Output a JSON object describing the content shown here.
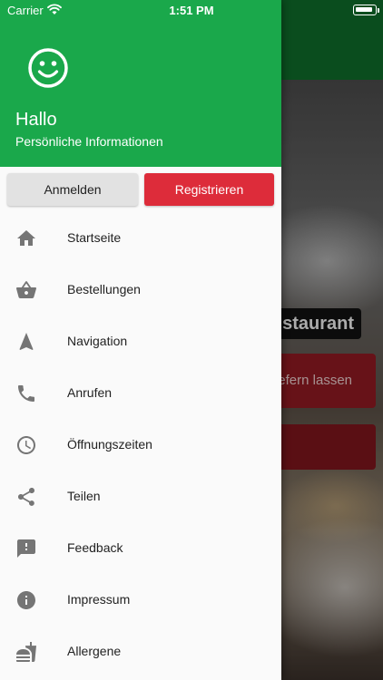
{
  "status_bar": {
    "carrier": "Carrier",
    "time": "1:51 PM"
  },
  "drawer": {
    "title": "Hallo",
    "subtitle": "Persönliche Informationen",
    "login_label": "Anmelden",
    "register_label": "Registrieren",
    "items": [
      {
        "label": "Startseite",
        "icon": "home-icon"
      },
      {
        "label": "Bestellungen",
        "icon": "basket-icon"
      },
      {
        "label": "Navigation",
        "icon": "navigation-arrow-icon"
      },
      {
        "label": "Anrufen",
        "icon": "phone-icon"
      },
      {
        "label": "Öffnungszeiten",
        "icon": "clock-icon"
      },
      {
        "label": "Teilen",
        "icon": "share-icon"
      },
      {
        "label": "Feedback",
        "icon": "feedback-icon"
      },
      {
        "label": "Impressum",
        "icon": "info-icon"
      },
      {
        "label": "Allergene",
        "icon": "food-icon"
      }
    ]
  },
  "background": {
    "restaurant_label": "staurant",
    "deliver_label": "efern lassen"
  },
  "colors": {
    "drawer_header": "#1aa84b",
    "register_button": "#dd2c3a",
    "login_button": "#e2e2e2",
    "icon_gray": "#757575"
  }
}
